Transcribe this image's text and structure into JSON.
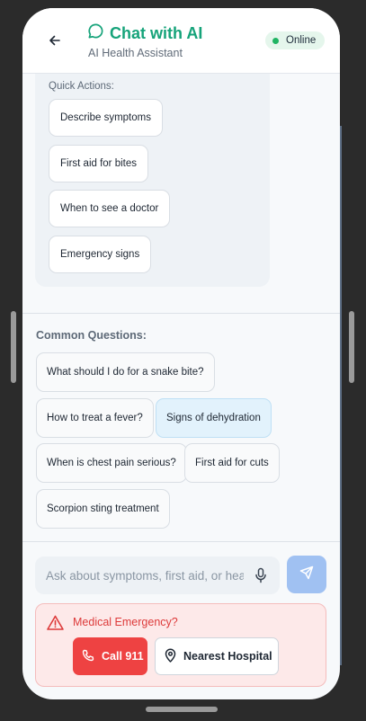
{
  "header": {
    "back_icon": "arrow-left-icon",
    "chat_icon": "message-circle-icon",
    "title": "Chat with AI",
    "subtitle": "AI Health Assistant",
    "status": "Online",
    "accent": "#16a37a"
  },
  "quick_actions": {
    "label": "Quick Actions:",
    "items": [
      "Describe symptoms",
      "First aid for bites",
      "When to see a doctor",
      "Emergency signs"
    ]
  },
  "common_questions": {
    "label": "Common Questions:",
    "items": [
      "What should I do for a snake bite?",
      "How to treat a fever?",
      "Signs of dehydration",
      "When is chest pain serious?",
      "First aid for cuts",
      "Scorpion sting treatment"
    ]
  },
  "composer": {
    "placeholder": "Ask about symptoms, first aid, or health",
    "mic_icon": "microphone-icon",
    "send_icon": "send-icon"
  },
  "emergency": {
    "title": "Medical Emergency?",
    "warning_icon": "alert-triangle-icon",
    "call_label": "Call 911",
    "call_icon": "phone-icon",
    "hospital_label": "Nearest Hospital",
    "hospital_icon": "map-pin-icon",
    "color": "#ee4242"
  }
}
